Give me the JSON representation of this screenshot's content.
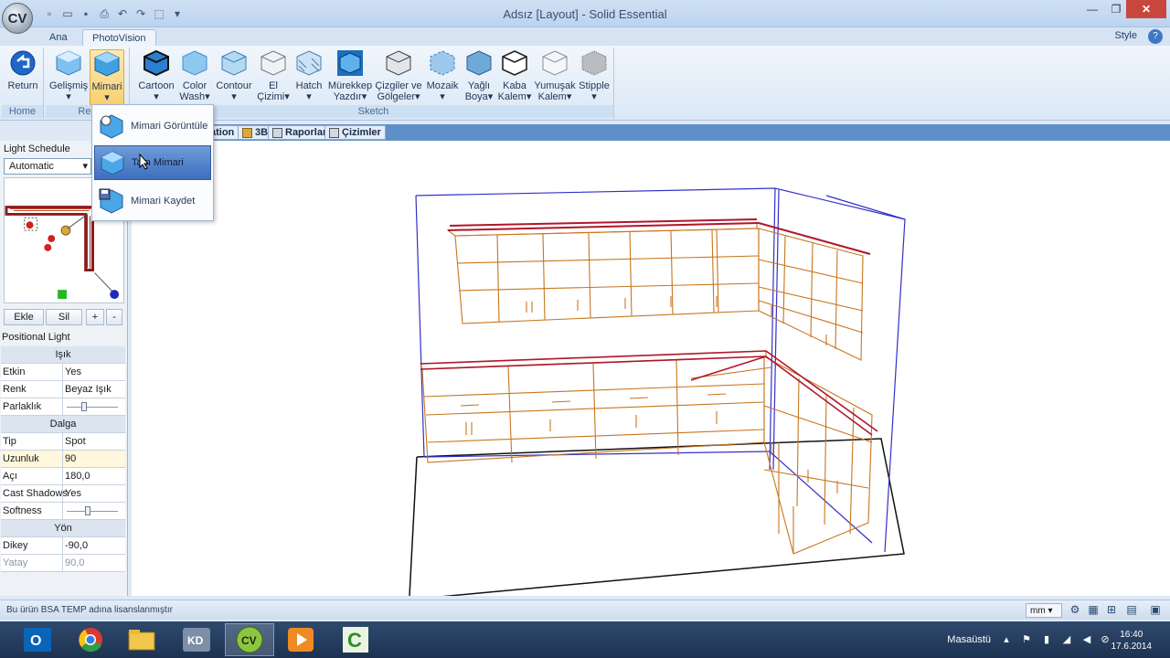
{
  "window": {
    "title": "Adsız [Layout] - Solid Essential",
    "logo_text": "CV"
  },
  "tabs": [
    {
      "label": "Ana"
    },
    {
      "label": "PhotoVision"
    }
  ],
  "style_label": "Style",
  "ribbon": {
    "groups": [
      {
        "label": "Home"
      },
      {
        "label": "Ren"
      },
      {
        "label": "Sketch"
      }
    ],
    "buttons": {
      "return": "Return",
      "gelismis": "Gelişmiş",
      "mimari": "Mimari",
      "cartoon": "Cartoon",
      "color_wash_1": "Color",
      "color_wash_2": "Wash",
      "contour": "Contour",
      "el_1": "El",
      "el_2": "Çizimi",
      "hatch": "Hatch",
      "murekkep_1": "Mürekkep",
      "murekkep_2": "Yazdır",
      "cizgiler_1": "Çizgiler ve",
      "cizgiler_2": "Gölgeler",
      "mozaik": "Mozaik",
      "yagli_1": "Yağlı",
      "yagli_2": "Boya",
      "kaba_1": "Kaba",
      "kaba_2": "Kalem",
      "yumusak_1": "Yumuşak",
      "yumusak_2": "Kalem",
      "stipple": "Stipple"
    }
  },
  "dropdown": {
    "items": [
      {
        "label": "Mimari Görüntüle"
      },
      {
        "label": "Tam Mimari"
      },
      {
        "label": "Mimari Kaydet"
      }
    ]
  },
  "doc_tabs": [
    {
      "label": "ation"
    },
    {
      "label": "3B"
    },
    {
      "label": "Raporlar"
    },
    {
      "label": "Çizimler"
    }
  ],
  "left_panel": {
    "title": "Light Schedule",
    "select_value": "Automatic",
    "buttons": {
      "add": "Ekle",
      "delete": "Sil",
      "plus": "+",
      "minus": "-"
    },
    "positional_light": "Positional Light",
    "sections": {
      "isik": "Işık",
      "dalga": "Dalga",
      "yon": "Yön"
    },
    "props": {
      "etkin": {
        "key": "Etkin",
        "value": "Yes"
      },
      "renk": {
        "key": "Renk",
        "value": "Beyaz Işık"
      },
      "parlaklik": {
        "key": "Parlaklık"
      },
      "tip": {
        "key": "Tip",
        "value": "Spot"
      },
      "uzunluk": {
        "key": "Uzunluk",
        "value": "90"
      },
      "aci": {
        "key": "Açı",
        "value": "180,0"
      },
      "cast": {
        "key": "Cast Shadows",
        "value": "Yes"
      },
      "softness": {
        "key": "Softness"
      },
      "dikey": {
        "key": "Dikey",
        "value": "-90,0"
      },
      "yatay": {
        "key": "Yatay",
        "value": "90,0"
      }
    }
  },
  "status": {
    "text": "Bu ürün BSA TEMP adına lisanslanmıştır",
    "unit": "mm"
  },
  "taskbar": {
    "desktop_label": "Masaüstü",
    "time": "16:40",
    "date": "17.6.2014"
  },
  "colors": {
    "accent": "#3e6fbf",
    "model_orange": "#c8761e",
    "model_red": "#b0162a",
    "room_blue": "#3330c8"
  }
}
